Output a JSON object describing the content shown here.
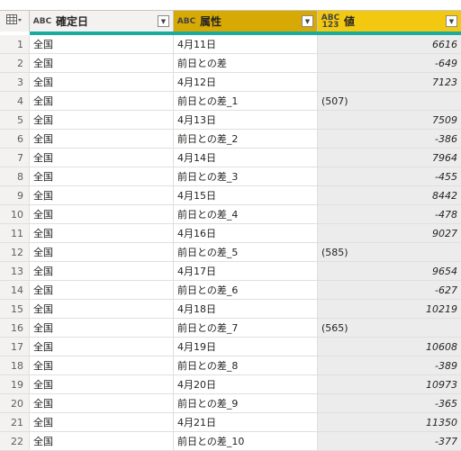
{
  "columns": [
    {
      "type_icon": "ABC",
      "name": "確定日"
    },
    {
      "type_icon": "ABC",
      "name": "属性"
    },
    {
      "type_icon": "ABC 123",
      "name": "値"
    }
  ],
  "rows": [
    {
      "n": "1",
      "c1": "全国",
      "c2": "4月11日",
      "v": "6616",
      "kind": "num"
    },
    {
      "n": "2",
      "c1": "全国",
      "c2": "前日との差",
      "v": "-649",
      "kind": "num"
    },
    {
      "n": "3",
      "c1": "全国",
      "c2": "4月12日",
      "v": "7123",
      "kind": "num"
    },
    {
      "n": "4",
      "c1": "全国",
      "c2": "前日との差_1",
      "v": "(507)",
      "kind": "txt"
    },
    {
      "n": "5",
      "c1": "全国",
      "c2": "4月13日",
      "v": "7509",
      "kind": "num"
    },
    {
      "n": "6",
      "c1": "全国",
      "c2": "前日との差_2",
      "v": "-386",
      "kind": "num"
    },
    {
      "n": "7",
      "c1": "全国",
      "c2": "4月14日",
      "v": "7964",
      "kind": "num"
    },
    {
      "n": "8",
      "c1": "全国",
      "c2": "前日との差_3",
      "v": "-455",
      "kind": "num"
    },
    {
      "n": "9",
      "c1": "全国",
      "c2": "4月15日",
      "v": "8442",
      "kind": "num"
    },
    {
      "n": "10",
      "c1": "全国",
      "c2": "前日との差_4",
      "v": "-478",
      "kind": "num"
    },
    {
      "n": "11",
      "c1": "全国",
      "c2": "4月16日",
      "v": "9027",
      "kind": "num"
    },
    {
      "n": "12",
      "c1": "全国",
      "c2": "前日との差_5",
      "v": "(585)",
      "kind": "txt"
    },
    {
      "n": "13",
      "c1": "全国",
      "c2": "4月17日",
      "v": "9654",
      "kind": "num"
    },
    {
      "n": "14",
      "c1": "全国",
      "c2": "前日との差_6",
      "v": "-627",
      "kind": "num"
    },
    {
      "n": "15",
      "c1": "全国",
      "c2": "4月18日",
      "v": "10219",
      "kind": "num"
    },
    {
      "n": "16",
      "c1": "全国",
      "c2": "前日との差_7",
      "v": "(565)",
      "kind": "txt"
    },
    {
      "n": "17",
      "c1": "全国",
      "c2": "4月19日",
      "v": "10608",
      "kind": "num"
    },
    {
      "n": "18",
      "c1": "全国",
      "c2": "前日との差_8",
      "v": "-389",
      "kind": "num"
    },
    {
      "n": "19",
      "c1": "全国",
      "c2": "4月20日",
      "v": "10973",
      "kind": "num"
    },
    {
      "n": "20",
      "c1": "全国",
      "c2": "前日との差_9",
      "v": "-365",
      "kind": "num"
    },
    {
      "n": "21",
      "c1": "全国",
      "c2": "4月21日",
      "v": "11350",
      "kind": "num"
    },
    {
      "n": "22",
      "c1": "全国",
      "c2": "前日との差_10",
      "v": "-377",
      "kind": "num"
    }
  ],
  "colors": {
    "quality_bar": "#1aab9b",
    "attr_header": "#d6a904",
    "value_header": "#f2c811"
  }
}
